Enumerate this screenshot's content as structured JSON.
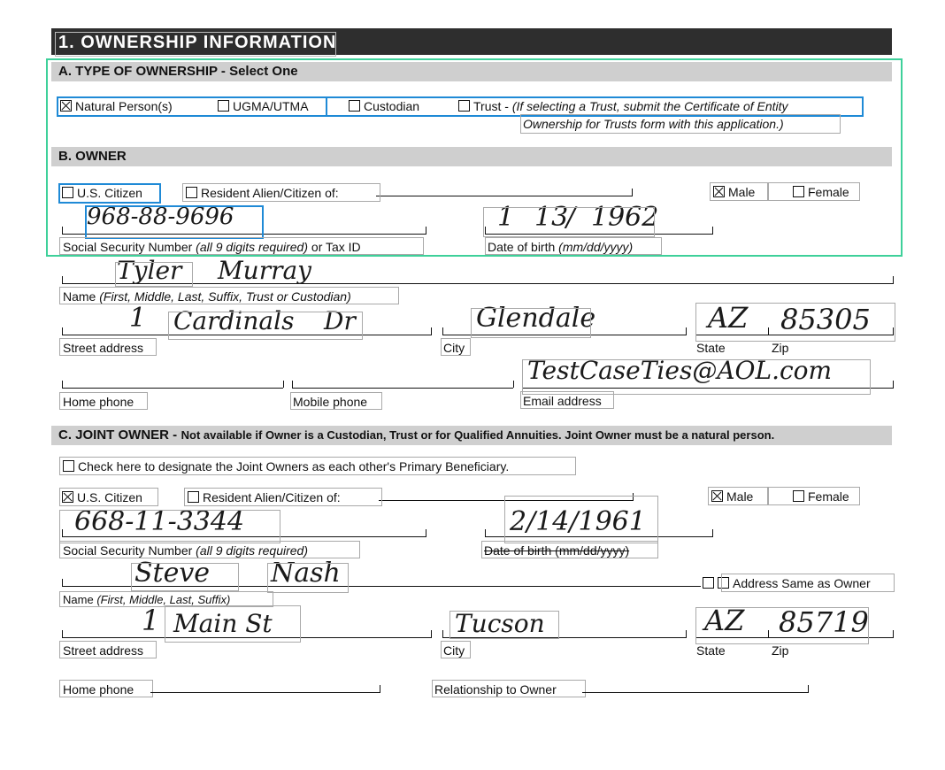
{
  "title": "1. OWNERSHIP INFORMATION",
  "section_a": {
    "heading": "A. TYPE OF OWNERSHIP - Select One",
    "options": {
      "natural": "Natural Person(s)",
      "ugma": "UGMA/UTMA",
      "custodian": "Custodian",
      "trust": "Trust -",
      "trust_note_1": "(If selecting a Trust, submit the Certificate of Entity",
      "trust_note_2": "Ownership for Trusts form with this application.)"
    }
  },
  "section_b": {
    "heading": "B. OWNER",
    "us_citizen": "U.S. Citizen",
    "resident_alien": "Resident Alien/Citizen of:",
    "male": "Male",
    "female": "Female",
    "ssn_label": "Social Security Number",
    "ssn_note": "(all 9 digits required)",
    "ssn_suffix": "or Tax ID",
    "dob_label": "Date of birth",
    "dob_note": "(mm/dd/yyyy)",
    "name_label": "Name",
    "name_note": "(First, Middle, Last, Suffix, Trust or Custodian)",
    "street_label": "Street address",
    "city_label": "City",
    "state_label": "State",
    "zip_label": "Zip",
    "home_phone_label": "Home phone",
    "mobile_phone_label": "Mobile phone",
    "email_label": "Email address",
    "values": {
      "ssn": "968-88-9696",
      "dob_m": "1",
      "dob_d": "13",
      "dob_y": "1962",
      "first": "Tyler",
      "last": "Murray",
      "street_num": "1",
      "street_name": "Cardinals",
      "street_suffix": "Dr",
      "city": "Glendale",
      "state": "AZ",
      "zip": "85305",
      "email": "TestCaseTies@AOL.com"
    }
  },
  "section_c": {
    "heading_bold": "C. JOINT OWNER -",
    "heading_rest": "Not available if Owner is a Custodian, Trust or for Qualified Annuities. Joint Owner must be a natural person.",
    "primary_beneficiary": "Check here to designate the Joint Owners as each other's Primary Beneficiary.",
    "us_citizen": "U.S. Citizen",
    "resident_alien": "Resident Alien/Citizen of:",
    "male": "Male",
    "female": "Female",
    "ssn_label": "Social Security Number",
    "ssn_note": "(all 9 digits required)",
    "dob_label": "Date of birth (mm/dd/yyyy)",
    "name_label": "Name",
    "name_note": "(First, Middle, Last, Suffix)",
    "same_address": "Address Same as Owner",
    "street_label": "Street address",
    "city_label": "City",
    "state_label": "State",
    "zip_label": "Zip",
    "home_phone_label": "Home phone",
    "relationship_label": "Relationship to Owner",
    "values": {
      "ssn": "668-11-3344",
      "dob": "2/14/1961",
      "first": "Steve",
      "last": "Nash",
      "street_num": "1",
      "street_name": "Main St",
      "city": "Tucson",
      "state": "AZ",
      "zip": "85719"
    }
  }
}
